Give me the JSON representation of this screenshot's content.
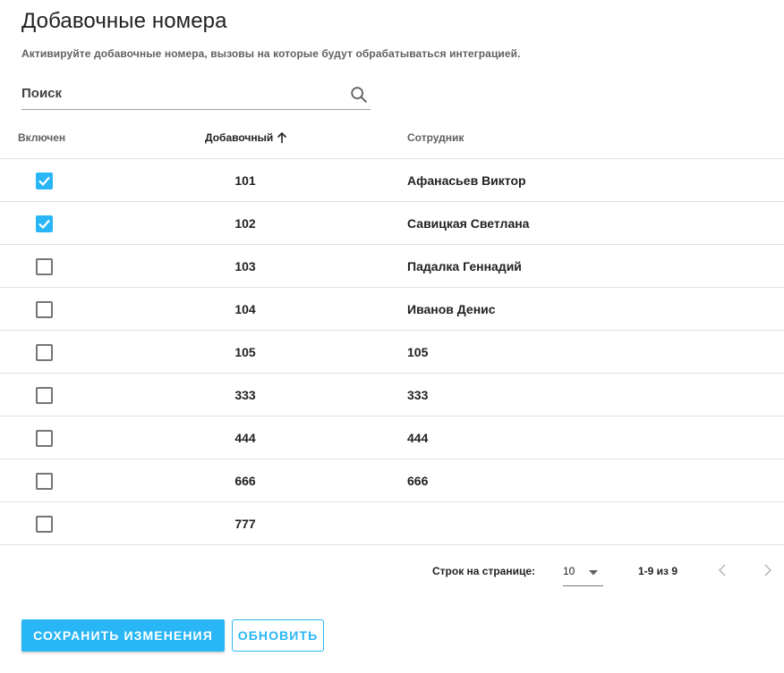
{
  "page": {
    "title": "Добавочные номера",
    "subtitle": "Активируйте добавочные номера, вызовы на которые будут обрабатываться интеграцией."
  },
  "search": {
    "placeholder": "Поиск",
    "value": "",
    "icon": "search-icon"
  },
  "table": {
    "headers": {
      "enabled": "Включен",
      "extension": "Добавочный",
      "employee": "Сотрудник"
    },
    "sort": {
      "column": "extension",
      "direction": "ascending",
      "icon": "arrow-up-icon"
    },
    "rows": [
      {
        "enabled": true,
        "extension": "101",
        "employee": "Афанасьев Виктор"
      },
      {
        "enabled": true,
        "extension": "102",
        "employee": "Савицкая Светлана"
      },
      {
        "enabled": false,
        "extension": "103",
        "employee": "Падалка Геннадий"
      },
      {
        "enabled": false,
        "extension": "104",
        "employee": "Иванов Денис"
      },
      {
        "enabled": false,
        "extension": "105",
        "employee": "105"
      },
      {
        "enabled": false,
        "extension": "333",
        "employee": "333"
      },
      {
        "enabled": false,
        "extension": "444",
        "employee": "444"
      },
      {
        "enabled": false,
        "extension": "666",
        "employee": "666"
      },
      {
        "enabled": false,
        "extension": "777",
        "employee": ""
      }
    ]
  },
  "pagination": {
    "rows_per_page_label": "Строк на странице:",
    "rows_per_page": "10",
    "range": "1-9 из 9",
    "prev_icon": "chevron-left-icon",
    "next_icon": "chevron-right-icon"
  },
  "actions": {
    "save_label": "СОХРАНИТЬ ИЗМЕНЕНИЯ",
    "refresh_label": "ОБНОВИТЬ"
  },
  "colors": {
    "accent": "#29b6f6",
    "divider": "#e0e0e0",
    "muted_text": "#616161"
  }
}
